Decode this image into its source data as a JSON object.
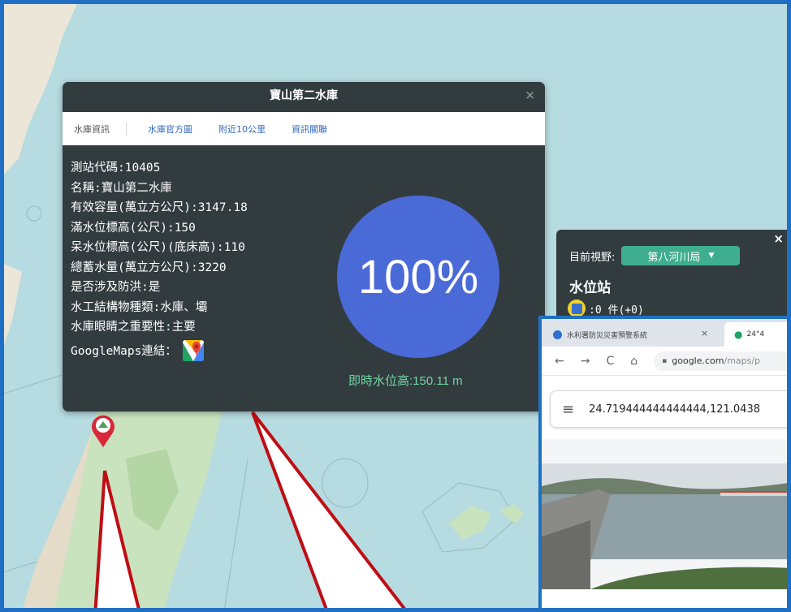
{
  "popup": {
    "title": "寶山第二水庫",
    "close": "×",
    "tabs": [
      "水庫資訊",
      "水庫官方圖",
      "附近10公里",
      "資訊關聯"
    ],
    "info_lines": [
      "測站代碼:10405",
      "名稱:寶山第二水庫",
      "有效容量(萬立方公尺):3147.18",
      "滿水位標高(公尺):150",
      "呆水位標高(公尺)(底床高):110",
      "總蓄水量(萬立方公尺):3220",
      "是否涉及防洪:是",
      "水工結構物種類:水庫、壩",
      "水庫眼睛之重要性:主要"
    ],
    "googlemaps_label": "GoogleMaps連結：",
    "percent": "100%",
    "water_level": "即時水位高:150.11 m"
  },
  "legend": {
    "view_label": "目前視野:",
    "view_select": "第八河川局",
    "close": "×",
    "heading": "水位站",
    "count_text": ":0 件(+0)"
  },
  "browser": {
    "tab1": "水利署防災災害預警系統",
    "tab1_close": "×",
    "tab2": "24°4",
    "nav_back": "←",
    "nav_forward": "→",
    "nav_reload": "C",
    "nav_home": "⌂",
    "url_host": "google.com",
    "url_path": "/maps/p",
    "menu": "≡",
    "search_value": "24.719444444444444,121.0438"
  },
  "colors": {
    "accent_blue": "#1f6fc4",
    "popup_bg": "#323c3f",
    "gauge_blue": "#4a6ad8",
    "level_green": "#6fd6a2",
    "pin_red": "#d9283a",
    "select_green": "#3fae8e",
    "arrow_red": "#c00d14"
  },
  "icons": {
    "pin": "map-pin-icon",
    "googlemaps": "google-maps-icon",
    "legend_station": "water-station-icon"
  }
}
